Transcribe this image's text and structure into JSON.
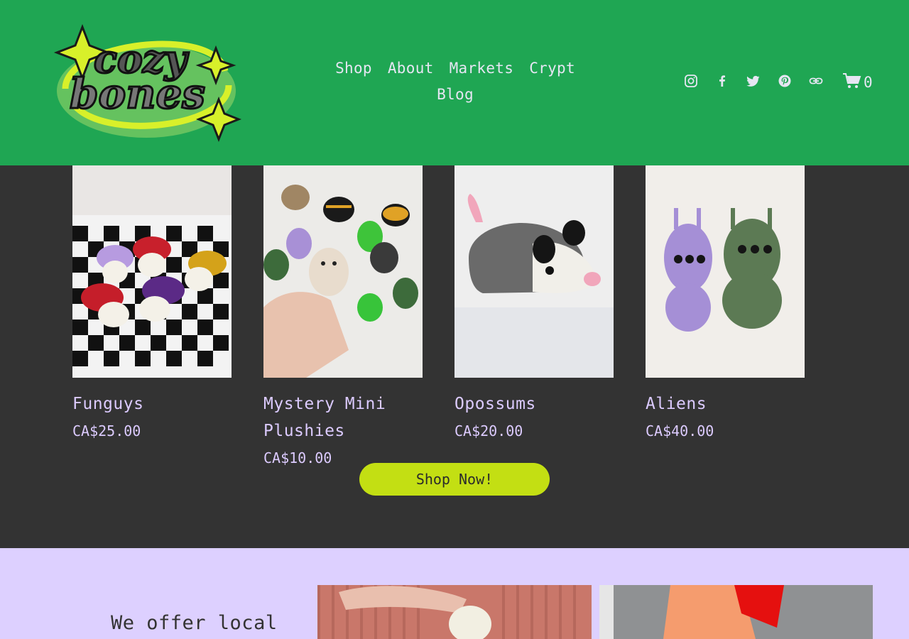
{
  "brand": {
    "logo_text": "cozy bones"
  },
  "nav": {
    "items": [
      {
        "label": "Shop"
      },
      {
        "label": "About"
      },
      {
        "label": "Markets"
      },
      {
        "label": "Crypt"
      },
      {
        "label": "Blog"
      }
    ]
  },
  "social": {
    "icons": [
      "instagram-icon",
      "facebook-icon",
      "twitter-icon",
      "pinterest-icon",
      "link-icon"
    ]
  },
  "cart": {
    "count": "0"
  },
  "products": [
    {
      "name": "Funguys",
      "price": "CA$25.00"
    },
    {
      "name": "Mystery Mini Plushies",
      "price": "CA$10.00"
    },
    {
      "name": "Opossums",
      "price": "CA$20.00"
    },
    {
      "name": "Aliens",
      "price": "CA$40.00"
    }
  ],
  "cta": {
    "shop_now_label": "Shop Now!"
  },
  "lower": {
    "text": "We offer local"
  },
  "colors": {
    "header_bg": "#1fa653",
    "dark_bg": "#333333",
    "lavender": "#ddd0ff",
    "accent_lime": "#c3df13",
    "product_text": "#dccbff"
  }
}
